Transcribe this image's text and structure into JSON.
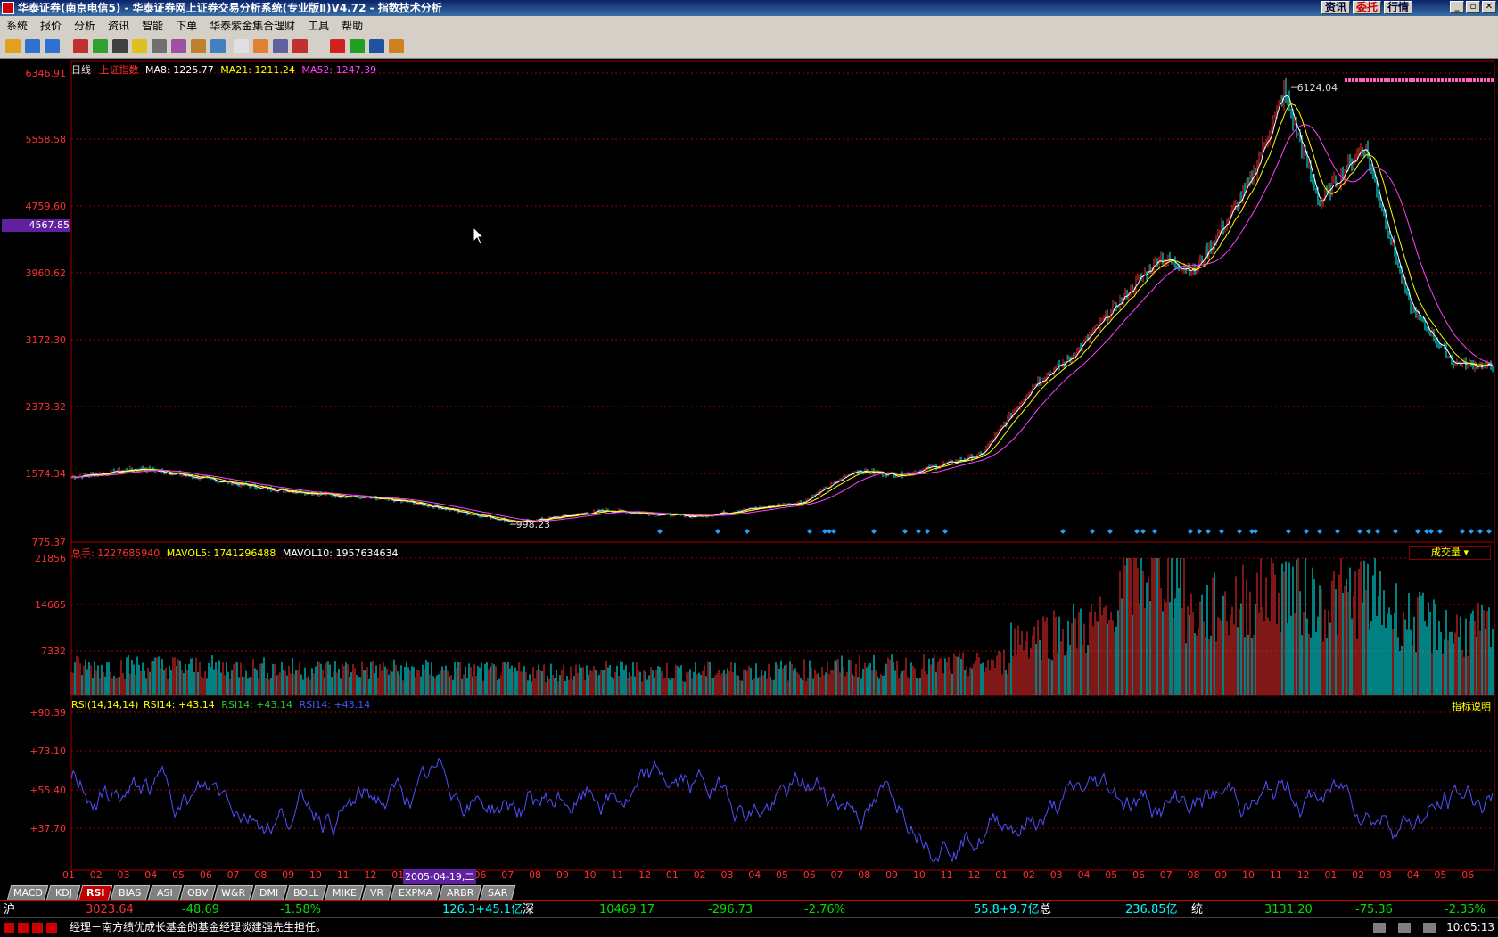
{
  "window": {
    "title": "华泰证券(南京电信5) - 华泰证券网上证券交易分析系统(专业版Ⅱ)V4.72 - 指数技术分析",
    "buttons": [
      "资讯",
      "委托",
      "行情"
    ]
  },
  "menu": [
    "系统",
    "报价",
    "分析",
    "资讯",
    "智能",
    "下单",
    "华泰紫金集合理财",
    "工具",
    "帮助"
  ],
  "main_panel": {
    "period": "日线",
    "security": "上证指数",
    "ma8": "MA8: 1225.77",
    "ma21": "MA21: 1211.24",
    "ma52": "MA52: 1247.39",
    "y_ticks": [
      "6346.91",
      "5558.58",
      "4759.60",
      "3960.62",
      "3172.30",
      "2373.32",
      "1574.34",
      "775.37"
    ],
    "y_highlight": "4567.85",
    "high_label": "6124.04",
    "low_label": "998.23"
  },
  "volume_panel": {
    "total": "总手: 1227685940",
    "mavol5": "MAVOL5: 1741296488",
    "mavol10": "MAVOL10: 1957634634",
    "y_ticks": [
      "21856",
      "14665",
      "7332"
    ],
    "selector": "成交量"
  },
  "rsi_panel": {
    "title": "RSI(14,14,14)",
    "rsi1": "RSI14: +43.14",
    "rsi2": "RSI14: +43.14",
    "rsi3": "RSI14: +43.14",
    "y_ticks": [
      "+90.39",
      "+73.10",
      "+55.40",
      "+37.70"
    ],
    "help": "指标说明"
  },
  "x_axis": {
    "months": [
      "01",
      "02",
      "03",
      "04",
      "05",
      "06",
      "07",
      "08",
      "09",
      "10",
      "11",
      "12",
      "01",
      "0",
      "05",
      "06",
      "07",
      "08",
      "09",
      "10",
      "11",
      "12",
      "01",
      "02",
      "03",
      "04",
      "05",
      "06",
      "07",
      "08",
      "09",
      "10",
      "11",
      "12",
      "01",
      "02",
      "03",
      "04",
      "05",
      "06",
      "07",
      "08",
      "09",
      "10",
      "11",
      "12",
      "01",
      "02",
      "03",
      "04",
      "05",
      "06"
    ],
    "cursor_date": "2005-04-19,二"
  },
  "indicator_tabs": [
    "MACD",
    "KDJ",
    "RSI",
    "BIAS",
    "ASI",
    "OBV",
    "W&R",
    "DMI",
    "BOLL",
    "MIKE",
    "VR",
    "EXPMA",
    "ARBR",
    "SAR"
  ],
  "active_tab": "RSI",
  "status": {
    "sh_label": "沪",
    "sh_index": "3023.64",
    "sh_change": "-48.69",
    "sh_pct": "-1.58%",
    "sh_amount": "126.3+45.1亿",
    "sz_label": "深",
    "sz_index": "10469.17",
    "sz_change": "-296.73",
    "sz_pct": "-2.76%",
    "sz_amount": "55.8+9.7亿",
    "total_label": "总",
    "total_amount": "236.85亿",
    "tong_label": "统",
    "tong_index": "3131.20",
    "tong_change": "-75.36",
    "tong_pct": "-2.35%"
  },
  "ticker": {
    "text": "经理－南方绩优成长基金的基金经理谈建强先生担任。",
    "time": "10:05:13"
  },
  "colors": {
    "up": "#ff3030",
    "down": "#00ffff",
    "ma8": "#ffffff",
    "ma21": "#ffff00",
    "ma52": "#ff40ff",
    "rsi": "#5050ff",
    "grid": "#a00000"
  }
}
